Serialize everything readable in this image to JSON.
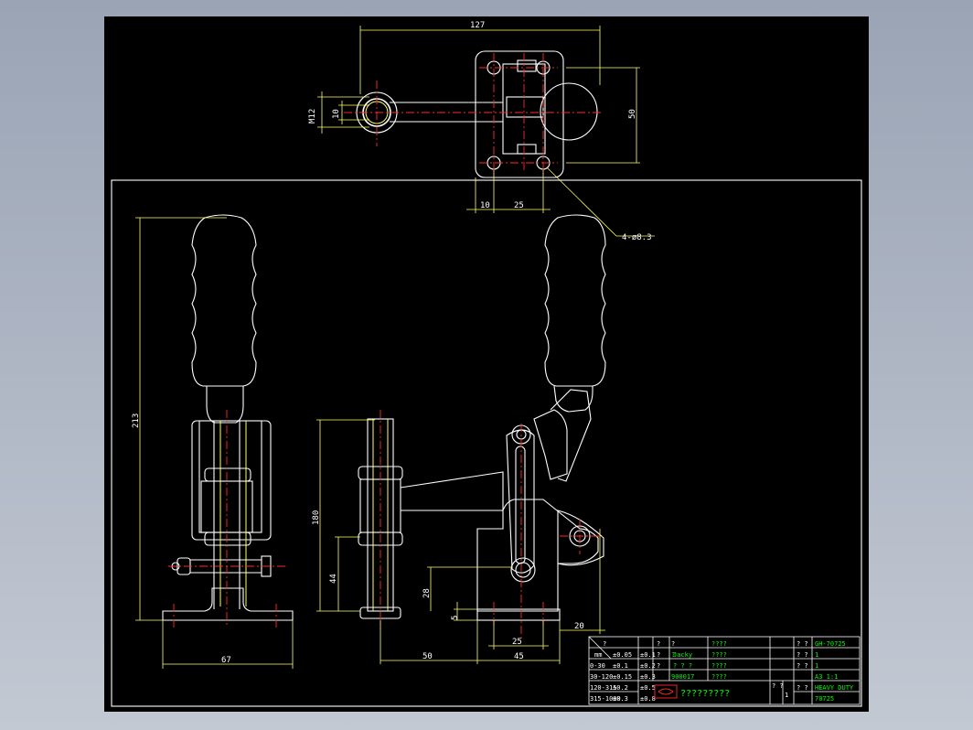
{
  "drawing": {
    "dims": {
      "d127": "127",
      "m12": "M12",
      "d10v": "10",
      "d50v": "50",
      "d10h": "10",
      "d25h": "25",
      "holes": "4-ø8.3",
      "d213": "213",
      "d67": "67",
      "d180": "180",
      "d44": "44",
      "d28": "28",
      "d5": "5",
      "d50h": "50",
      "d25b": "25",
      "d45": "45",
      "d20": "20"
    },
    "title_block": {
      "r1c1": "?",
      "r1c2": "?",
      "r1c3": "????",
      "r2c1": "?",
      "r2c2": "?",
      "r2c3": "Jacky",
      "r2c4": "????",
      "r3c1": "?",
      "r3c2": "?",
      "r3c3": "? ? ?",
      "r3c4": "????",
      "r4c3": "900017",
      "r4c4": "????",
      "company": "?????????",
      "scale_num": "1",
      "q1": "? ?",
      "q2": "? ?",
      "q3": "? ?",
      "q4": "? ?",
      "q5": "? ?",
      "v1": "GH-70725",
      "v2": "1",
      "v3": "1",
      "v4": "A3  1:1",
      "v5": "HEAVY DUTY",
      "v6": "70725",
      "tol": [
        [
          "?",
          "mm",
          "±0.05",
          "±0.1",
          "±0.2"
        ],
        [
          "0-30",
          "±0.1",
          "±0.2",
          "±0.3"
        ],
        [
          "30-120",
          "±0.15",
          "±0.3",
          "±0.5"
        ],
        [
          "120-315",
          "±0.2",
          "±0.5",
          "±0.8"
        ],
        [
          "315-1000",
          "±0.3",
          "±0.8",
          "±1.2"
        ],
        [
          "±0",
          "0.3",
          "?",
          "?"
        ]
      ]
    }
  }
}
